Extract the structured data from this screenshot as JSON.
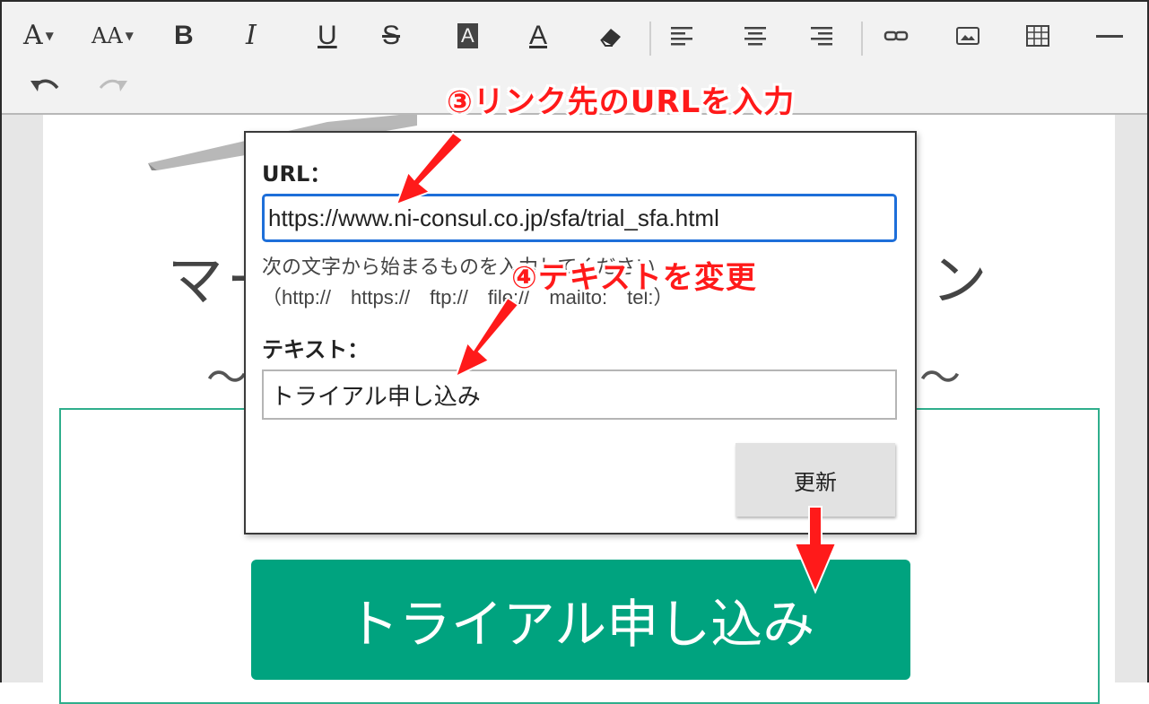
{
  "toolbar": {
    "font_label": "A",
    "font_size_label": "AA",
    "bold_label": "B",
    "italic_label": "I",
    "underline_label": "U",
    "strike_label": "S",
    "bg_color_label": "A",
    "font_color_label": "A",
    "icons": [
      "font-icon",
      "font-size-icon",
      "bold-icon",
      "italic-icon",
      "underline-icon",
      "strikethrough-icon",
      "background-color-icon",
      "font-color-icon",
      "eraser-icon",
      "align-left-icon",
      "align-center-icon",
      "align-right-icon",
      "link-icon",
      "image-icon",
      "table-icon",
      "horizontal-rule-icon",
      "undo-icon",
      "redo-icon"
    ]
  },
  "editor": {
    "heading": "マーケティングソリューション",
    "tilde_left": "〜",
    "tilde_right": "〜",
    "trial_button_label": "トライアル申し込み"
  },
  "dialog": {
    "url_label": "URL：",
    "url_value": "https://www.ni-consul.co.jp/sfa/trial_sfa.html",
    "hint_line1": "次の文字から始まるものを入力してください",
    "hint_line2": "（http://　https://　ftp://　file://　mailto:　tel:）",
    "text_label": "テキスト：",
    "text_value": "トライアル申し込み",
    "update_button_label": "更新"
  },
  "annotations": {
    "step3": "③リンク先のURLを入力",
    "step4": "④テキストを変更",
    "color": "#ff1a1a"
  },
  "colors": {
    "accent_green": "#00a37f",
    "focus_blue": "#1e6fd9",
    "toolbar_bg": "#f2f2f2"
  }
}
